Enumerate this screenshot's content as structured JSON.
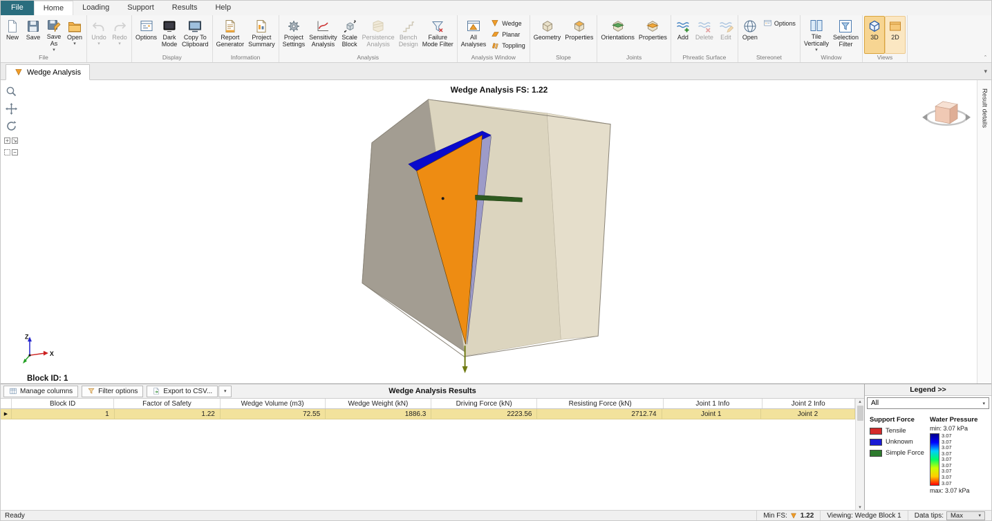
{
  "app": {
    "accent": "#e8a33d",
    "file_tab_color": "#2a6d7e"
  },
  "menu_tabs": [
    {
      "label": "File",
      "file": true
    },
    {
      "label": "Home",
      "active": true
    },
    {
      "label": "Loading"
    },
    {
      "label": "Support"
    },
    {
      "label": "Results"
    },
    {
      "label": "Help"
    }
  ],
  "ribbon": {
    "groups": [
      {
        "label": "File",
        "items": [
          {
            "label": "New",
            "icon": "new-document"
          },
          {
            "label": "Save",
            "icon": "save"
          },
          {
            "label": "Save\nAs",
            "icon": "save-as",
            "dropdown": true
          },
          {
            "label": "Open",
            "icon": "open-folder",
            "dropdown": true
          }
        ]
      },
      {
        "label": "",
        "items": [
          {
            "label": "Undo",
            "icon": "undo",
            "dropdown": true,
            "disabled": true
          },
          {
            "label": "Redo",
            "icon": "redo",
            "dropdown": true,
            "disabled": true
          }
        ]
      },
      {
        "label": "Display",
        "items": [
          {
            "label": "Options",
            "icon": "display-options"
          },
          {
            "label": "Dark\nMode",
            "icon": "dark-mode"
          },
          {
            "label": "Copy To\nClipboard",
            "icon": "copy-clipboard"
          }
        ]
      },
      {
        "label": "Information",
        "items": [
          {
            "label": "Report\nGenerator",
            "icon": "report-generator"
          },
          {
            "label": "Project\nSummary",
            "icon": "project-summary"
          }
        ]
      },
      {
        "label": "Analysis",
        "items": [
          {
            "label": "Project\nSettings",
            "icon": "project-settings"
          },
          {
            "label": "Sensitivity\nAnalysis",
            "icon": "sensitivity-analysis"
          },
          {
            "label": "Scale\nBlock",
            "icon": "scale-block"
          },
          {
            "label": "Persistence\nAnalysis",
            "icon": "persistence-analysis",
            "disabled": true
          },
          {
            "label": "Bench\nDesign",
            "icon": "bench-design",
            "disabled": true
          },
          {
            "label": "Failure\nMode Filter",
            "icon": "failure-mode-filter"
          }
        ]
      },
      {
        "label": "Analysis Window",
        "items": [
          {
            "label": "All\nAnalyses",
            "icon": "all-analyses"
          },
          {
            "stack": [
              {
                "label": "Wedge",
                "icon": "wedge"
              },
              {
                "label": "Planar",
                "icon": "planar"
              },
              {
                "label": "Toppling",
                "icon": "toppling"
              }
            ]
          }
        ]
      },
      {
        "label": "Slope",
        "items": [
          {
            "label": "Geometry",
            "icon": "slope-geometry"
          },
          {
            "label": "Properties",
            "icon": "slope-properties"
          }
        ]
      },
      {
        "label": "Joints",
        "items": [
          {
            "label": "Orientations",
            "icon": "joint-orientations"
          },
          {
            "label": "Properties",
            "icon": "joint-properties"
          }
        ]
      },
      {
        "label": "Phreatic Surface",
        "items": [
          {
            "label": "Add",
            "icon": "phreatic-add"
          },
          {
            "label": "Delete",
            "icon": "phreatic-delete",
            "disabled": true
          },
          {
            "label": "Edit",
            "icon": "phreatic-edit",
            "disabled": true
          }
        ]
      },
      {
        "label": "Stereonet",
        "items": [
          {
            "label": "Open",
            "icon": "stereonet-open"
          },
          {
            "stack": [
              {
                "label": "Options",
                "icon": "stereonet-options"
              }
            ]
          }
        ]
      },
      {
        "label": "Window",
        "items": [
          {
            "label": "Tile\nVertically",
            "icon": "tile-vertically",
            "dropdown": true
          },
          {
            "label": "Selection\nFilter",
            "icon": "selection-filter"
          }
        ]
      },
      {
        "label": "Views",
        "items": [
          {
            "label": "3D",
            "icon": "view-3d",
            "highlight": true,
            "selected": true
          },
          {
            "label": "2D",
            "icon": "view-2d",
            "highlight": true
          }
        ]
      }
    ]
  },
  "viewport": {
    "doc_tab": "Wedge Analysis",
    "title": "Wedge Analysis FS: 1.22",
    "block_id": "Block ID: 1",
    "result_details": "Result details",
    "axis": {
      "x": "X",
      "z": "Z"
    }
  },
  "scene": {
    "colors": {
      "block_gray": "#a39d92",
      "block_mid": "#dcd5bf",
      "block_light": "#e5decb",
      "outline": "#8a8478",
      "wedge_blue": "#0a0acc",
      "wedge_lavender": "#9d9bc8",
      "wedge_orange": "#ee8c12",
      "force_green": "#2e5a1f",
      "arrow_olive": "#6f7a12"
    }
  },
  "results": {
    "toolbar": {
      "manage_columns": "Manage columns",
      "filter_options": "Filter options",
      "export_csv": "Export to CSV...",
      "title": "Wedge Analysis Results"
    },
    "columns": [
      "Block ID",
      "Factor of Safety",
      "Wedge Volume (m3)",
      "Wedge Weight (kN)",
      "Driving Force (kN)",
      "Resisting Force (kN)",
      "Joint 1 Info",
      "Joint 2 Info"
    ],
    "rows": [
      [
        "1",
        "1.22",
        "72.55",
        "1886.3",
        "2223.56",
        "2712.74",
        "Joint 1",
        "Joint 2"
      ]
    ]
  },
  "legend": {
    "title": "Legend >>",
    "filter_value": "All",
    "support_force": {
      "title": "Support Force",
      "items": [
        {
          "label": "Tensile",
          "color": "#d42a2a"
        },
        {
          "label": "Unknown",
          "color": "#1a1ad4"
        },
        {
          "label": "Simple Force",
          "color": "#2d7a2d"
        }
      ]
    },
    "water_pressure": {
      "title": "Water Pressure",
      "min": "min: 3.07 kPa",
      "max": "max: 3.07 kPa",
      "ticks": [
        "3.07",
        "3.07",
        "3.07",
        "3.07",
        "3.07",
        "3.07",
        "3.07",
        "3.07",
        "3.07"
      ],
      "gradient": [
        "#000088",
        "#0000ff",
        "#00ccff",
        "#00ff66",
        "#ccff00",
        "#ffcc00",
        "#ff0000"
      ]
    }
  },
  "statusbar": {
    "ready": "Ready",
    "min_fs_label": "Min FS:",
    "min_fs_value": "1.22",
    "viewing": "Viewing: Wedge Block 1",
    "data_tips_label": "Data tips:",
    "data_tips_value": "Max"
  }
}
